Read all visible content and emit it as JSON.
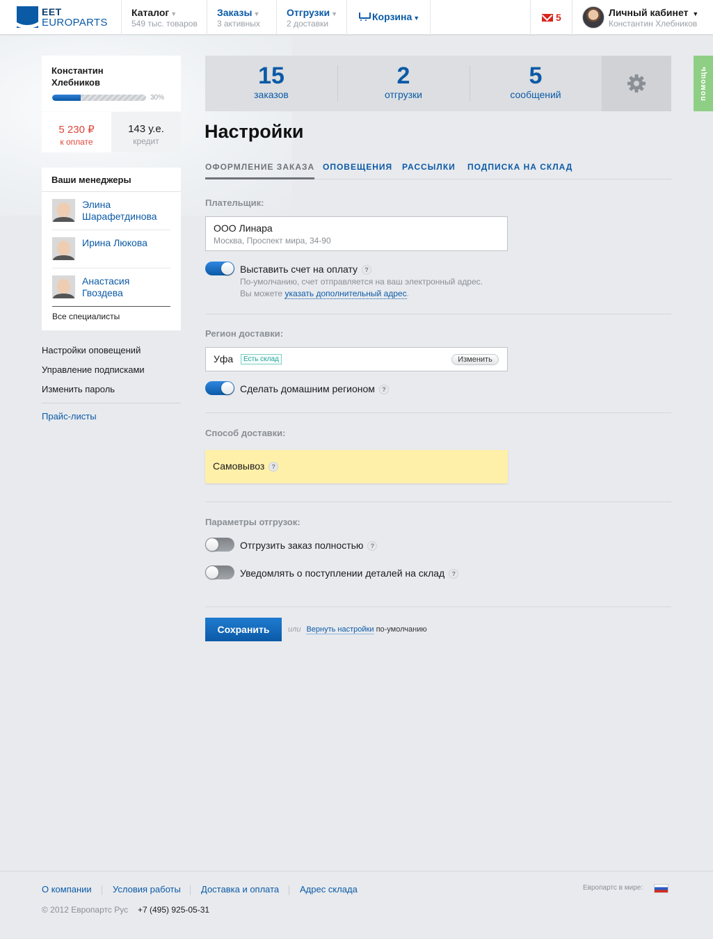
{
  "header": {
    "logo_line1": "EET",
    "logo_line2": "EUROPARTS",
    "nav": [
      {
        "title": "Каталог",
        "subtitle": "549 тыс. товаров"
      },
      {
        "title": "Заказы",
        "subtitle": "3 активных"
      },
      {
        "title": "Отгрузки",
        "subtitle": "2 доставки"
      },
      {
        "title": "Корзина"
      }
    ],
    "mail_count": "5",
    "account_title": "Личный кабинет",
    "account_user": "Константин Хлебников"
  },
  "help_tab": "помощь",
  "sidebar": {
    "user_name": "Константин Хлебников",
    "progress_percent": 30,
    "progress_label": "30%",
    "balance": {
      "to_pay_value": "5 230 ₽",
      "to_pay_label": "к оплате",
      "credit_value": "143 у.е.",
      "credit_label": "кредит"
    },
    "managers_title": "Ваши менеджеры",
    "managers": [
      {
        "name": "Элина Шарафетдинова"
      },
      {
        "name": "Ирина Люкова"
      },
      {
        "name": "Анастасия Гвоздева"
      }
    ],
    "all_specialists": "Все специалисты",
    "links": [
      "Настройки оповещений",
      "Управление подписками",
      "Изменить пароль"
    ],
    "price_lists": "Прайс-листы"
  },
  "stats": [
    {
      "number": "15",
      "label": "заказов"
    },
    {
      "number": "2",
      "label": "отгрузки"
    },
    {
      "number": "5",
      "label": "сообщений"
    }
  ],
  "page_title": "Настройки",
  "tabs": [
    "ОФОРМЛЕНИЕ ЗАКАЗА",
    "ОПОВЕЩЕНИЯ",
    "РАССЫЛКИ",
    "ПОДПИСКА НА СКЛАД"
  ],
  "payer": {
    "label": "Плательщик:",
    "name": "ООО Линара",
    "address": "Москва, Проспект мира, 34-90",
    "invoice_toggle_label": "Выставить счет на оплату",
    "invoice_toggle_on": true,
    "hint_line1": "По-умолчанию, счет отправляется на ваш электронный адрес.",
    "hint_line2_prefix": "Вы можете",
    "hint_link": "указать дополнительный адрес",
    "hint_line2_suffix": "."
  },
  "region": {
    "label": "Регион доставки:",
    "value": "Уфа",
    "badge": "Есть склад",
    "change_button": "Изменить",
    "home_toggle_label": "Сделать домашним регионом",
    "home_toggle_on": true
  },
  "delivery": {
    "label": "Способ доставки:",
    "value": "Самовывоз"
  },
  "shipment": {
    "label": "Параметры отгрузок:",
    "full_label": "Отгрузить заказ полностью",
    "full_on": false,
    "notify_label": "Уведомлять о поступлении деталей на склад",
    "notify_on": false
  },
  "actions": {
    "save": "Сохранить",
    "or": "или",
    "reset_link": "Вернуть настройки",
    "reset_suffix": "по-умолчанию"
  },
  "footer": {
    "links": [
      "О компании",
      "Условия работы",
      "Доставка и оплата",
      "Адрес склада"
    ],
    "copyright": "© 2012 Европартс Рус",
    "phone": "+7 (495) 925-05-31",
    "world_label": "Европартс в мире:"
  },
  "question_mark": "?",
  "colors": {
    "accent": "#0b5aa6",
    "danger": "#e0433a",
    "delivery_highlight": "#fff0a9",
    "help_tab": "#8fcf85"
  }
}
